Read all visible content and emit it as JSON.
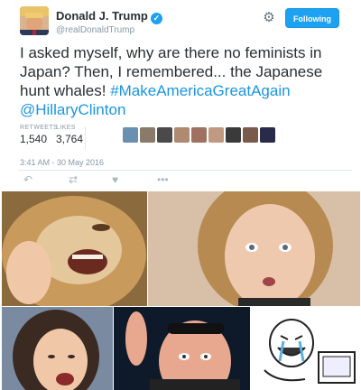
{
  "tweet": {
    "author_name": "Donald J. Trump",
    "handle": "@realDonaldTrump",
    "follow_label": "Following",
    "text_main": "I asked myself, why are there no feminists in Japan? Then, I remembered... the Japanese hunt whales! ",
    "hashtag": "#MakeAmericaGreatAgain",
    "mention": "@HillaryClinton",
    "retweets_label": "RETWEETS",
    "retweets_value": "1,540",
    "likes_label": "LIKES",
    "likes_value": "3,764",
    "timestamp": "3:41 AM - 30 May 2016",
    "icons": {
      "gear": "gear-icon",
      "verified": "verified-badge-icon",
      "reply": "reply-icon",
      "retweet": "retweet-icon",
      "like": "heart-icon",
      "more": "more-icon"
    }
  },
  "colors": {
    "accent": "#1da1f2",
    "link": "#1b95e0",
    "muted": "#8899a6",
    "text": "#292f33"
  },
  "reaction_images": [
    "lion-laughing-image",
    "surprised-woman-image",
    "laughing-woman-image",
    "man-lifting-sunglasses-image",
    "rage-comic-crying-laughing-image"
  ]
}
